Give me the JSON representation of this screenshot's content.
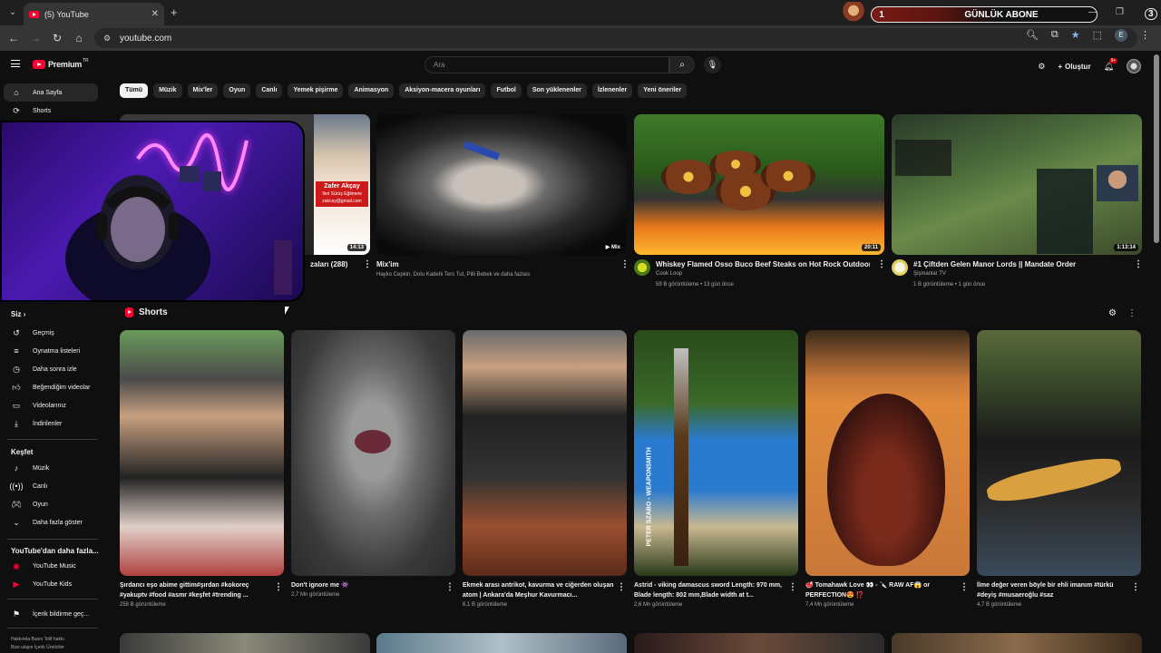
{
  "browser": {
    "tab_title": "(5) YouTube",
    "url": "youtube.com",
    "new_tab": "+",
    "tab_close": "✕"
  },
  "overlay": {
    "counter_left": "1",
    "label": "GÜNLÜK ABONE",
    "counter_right": "3"
  },
  "header": {
    "logo": "Premium",
    "logo_region": "TR",
    "search_placeholder": "Ara",
    "create_label": "Oluştur",
    "notif_count": "9+"
  },
  "sidebar": {
    "main": [
      {
        "label": "Ana Sayfa",
        "icon": "home-icon"
      },
      {
        "label": "Shorts",
        "icon": "shorts-icon"
      }
    ],
    "you_heading": "Siz",
    "you_items": [
      {
        "label": "Geçmiş",
        "icon": "history-icon"
      },
      {
        "label": "Oynatma listeleri",
        "icon": "playlist-icon"
      },
      {
        "label": "Daha sonra izle",
        "icon": "clock-icon"
      },
      {
        "label": "Beğendiğim videolar",
        "icon": "like-icon"
      },
      {
        "label": "Videolarınız",
        "icon": "video-icon"
      },
      {
        "label": "İndirilenler",
        "icon": "download-icon"
      }
    ],
    "explore_heading": "Keşfet",
    "explore_items": [
      {
        "label": "Müzik",
        "icon": "music-icon"
      },
      {
        "label": "Canlı",
        "icon": "live-icon"
      },
      {
        "label": "Oyun",
        "icon": "gaming-icon"
      },
      {
        "label": "Daha fazla göster",
        "icon": "chevron-down-icon"
      }
    ],
    "more_heading": "YouTube'dan daha fazla...",
    "more_items": [
      {
        "label": "YouTube Music",
        "icon": "yt-music-icon"
      },
      {
        "label": "YouTube Kids",
        "icon": "yt-kids-icon"
      }
    ],
    "report_item": {
      "label": "İçerik bildirme geç...",
      "icon": "flag-icon"
    },
    "footer_line1": "Hakkında  Basın  Telif hakkı",
    "footer_line2": "Bize ulaşın  İçerik Üreticiler"
  },
  "chips": [
    "Tümü",
    "Müzik",
    "Mix'ler",
    "Oyun",
    "Canlı",
    "Yemek pişirme",
    "Animasyon",
    "Aksiyon-macera oyunları",
    "Futbol",
    "Son yüklenenler",
    "İzlenenler",
    "Yeni öneriler"
  ],
  "videos": [
    {
      "title": "zaları (288)",
      "meta1": "",
      "meta2": "",
      "duration": "14:13"
    },
    {
      "title": "Mix'im",
      "meta1": "Hayko Cepkin, Dolu Kadehi Ters Tut, Pilli Bebek ve daha fazlası",
      "meta2": "",
      "duration": "Mix"
    },
    {
      "title": "Whiskey Flamed Osso Buco Beef Steaks on Hot Rock Outdoors",
      "meta1": "Cook Loop",
      "meta2": "59 B görüntüleme • 13 gün önce",
      "duration": "20:11"
    },
    {
      "title": "#1 Çiftden Gelen Manor Lords || Mandate Order",
      "meta1": "Şişmanlar TV",
      "meta2": "1 B görüntüleme • 1 gün önce",
      "duration": "1:13:14"
    }
  ],
  "thumb_text": {
    "name": "Zafer Akçay",
    "sub": "Ileri Sürüş Eğitmeni",
    "email": "zakcay@gmail.com"
  },
  "shorts": {
    "heading": "Shorts",
    "items": [
      {
        "title": "Şırdancı eşo abime gittim#şırdan #kokoreç #yakuptv #food #asmr #keşfet #trending ...",
        "views": "258 B görüntüleme"
      },
      {
        "title": "Don't ignore me 👾",
        "views": "2,7 Mn görüntüleme"
      },
      {
        "title": "Ekmek arası antrikot, kavurma ve ciğerden oluşan atom | Ankara'da Meşhur Kavurmacı...",
        "views": "6,1 B görüntüleme"
      },
      {
        "title": "Astrid - viking damascus sword Length: 970 mm, Blade length: 802 mm,Blade width at t...",
        "views": "2,6 Mn görüntüleme"
      },
      {
        "title": "🥩 Tomahawk Love 👀 - 🔪 RAW AF😱 or PERFECTION😍 ⁉️",
        "views": "7,4 Mn görüntüleme"
      },
      {
        "title": "İlme değer veren böyle bir ehli imanım #türkü #deyiş #musaeroğlu #saz",
        "views": "4,7 B görüntüleme"
      }
    ],
    "sword_text": "PETER SZABO - WEAPONSMITH"
  },
  "colors": {
    "accent": "#ff0033",
    "bg": "#0f0f0f",
    "chip_bg": "#272727"
  }
}
